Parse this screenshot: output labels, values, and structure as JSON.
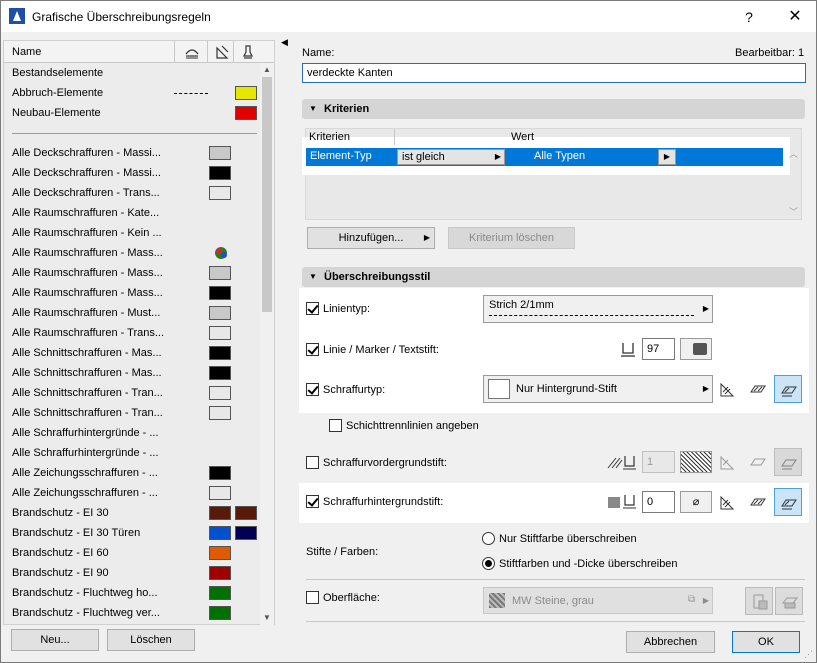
{
  "window": {
    "title": "Grafische Überschreibungsregeln",
    "help": "?",
    "close": "✕"
  },
  "left": {
    "header_name": "Name",
    "rules": [
      {
        "label": "Bestandselemente"
      },
      {
        "label": "Abbruch-Elemente",
        "swatches": [
          "#e6e600"
        ],
        "dashed": true
      },
      {
        "label": "Neubau-Elemente",
        "swatches": [
          "#e00000"
        ]
      },
      {
        "label": "Alle Deckschraffuren - Massi...",
        "swatches": [
          "#c8c8c8"
        ]
      },
      {
        "label": "Alle Deckschraffuren - Massi...",
        "swatches": [
          "#000000"
        ]
      },
      {
        "label": "Alle Deckschraffuren - Trans...",
        "swatches": [
          "#e8e8e8"
        ]
      },
      {
        "label": "Alle Raumschraffuren - Kate..."
      },
      {
        "label": "Alle Raumschraffuren - Kein ..."
      },
      {
        "label": "Alle Raumschraffuren - Mass...",
        "icon": true
      },
      {
        "label": "Alle Raumschraffuren - Mass...",
        "swatches": [
          "#c8c8c8"
        ]
      },
      {
        "label": "Alle Raumschraffuren - Mass...",
        "swatches": [
          "#000000"
        ]
      },
      {
        "label": "Alle Raumschraffuren - Must...",
        "swatches": [
          "#c8c8c8"
        ]
      },
      {
        "label": "Alle Raumschraffuren - Trans...",
        "swatches": [
          "#e8e8e8"
        ]
      },
      {
        "label": "Alle Schnittschraffuren - Mas...",
        "swatches": [
          "#000000"
        ]
      },
      {
        "label": "Alle Schnittschraffuren - Mas...",
        "swatches": [
          "#000000"
        ]
      },
      {
        "label": "Alle Schnittschraffuren - Tran...",
        "swatches": [
          "#e8e8e8"
        ]
      },
      {
        "label": "Alle Schnittschraffuren - Tran...",
        "swatches": [
          "#e8e8e8"
        ]
      },
      {
        "label": "Alle Schraffurhintergründe - ..."
      },
      {
        "label": "Alle Schraffurhintergründe - ..."
      },
      {
        "label": "Alle Zeichungsschraffuren - ...",
        "swatches": [
          "#000000"
        ]
      },
      {
        "label": "Alle Zeichungsschraffuren - ...",
        "swatches": [
          "#e8e8e8"
        ]
      },
      {
        "label": "Brandschutz - EI 30",
        "swatches": [
          "#5a1a0a",
          "#5a1a0a"
        ]
      },
      {
        "label": "Brandschutz - EI 30 Türen",
        "swatches": [
          "#0050d0",
          "#000050"
        ]
      },
      {
        "label": "Brandschutz - EI 60",
        "swatches": [
          "#e05a00"
        ]
      },
      {
        "label": "Brandschutz - EI 90",
        "swatches": [
          "#a00000"
        ]
      },
      {
        "label": "Brandschutz - Fluchtweg ho...",
        "swatches": [
          "#007000"
        ]
      },
      {
        "label": "Brandschutz - Fluchtweg ver...",
        "swatches": [
          "#007000"
        ]
      }
    ],
    "new_button": "Neu...",
    "delete_button": "Löschen"
  },
  "right": {
    "name_label": "Name:",
    "editable_label": "Bearbeitbar: 1",
    "name_value": "verdeckte Kanten",
    "criteria_header": "Kriterien",
    "col_criteria": "Kriterien",
    "col_value": "Wert",
    "criteria_row": {
      "type": "Element-Typ",
      "op": "ist gleich",
      "value": "Alle Typen"
    },
    "add_button": "Hinzufügen...",
    "delete_criterion_button": "Kriterium löschen",
    "style_header": "Überschreibungsstil",
    "linetype": {
      "label": "Linientyp:",
      "value": "Strich 2/1mm",
      "checked": true
    },
    "pen": {
      "label": "Linie / Marker / Textstift:",
      "value": "97",
      "checked": true
    },
    "hatch": {
      "label": "Schraffurtyp:",
      "value": "Nur Hintergrund-Stift",
      "checked": true
    },
    "layer_lines": {
      "label": "Schichttrennlinien angeben",
      "checked": false
    },
    "fg_pen": {
      "label": "Schraffurvordergrundstift:",
      "value": "1",
      "checked": false
    },
    "bg_pen": {
      "label": "Schraffurhintergrundstift:",
      "value": "0",
      "checked": true
    },
    "pens_label": "Stifte / Farben:",
    "radio1": "Nur Stiftfarbe überschreiben",
    "radio2": "Stiftfarben und -Dicke überschreiben",
    "surface": {
      "label": "Oberfläche:",
      "value": "MW Steine, grau",
      "checked": false
    },
    "cancel_button": "Abbrechen",
    "ok_button": "OK"
  }
}
